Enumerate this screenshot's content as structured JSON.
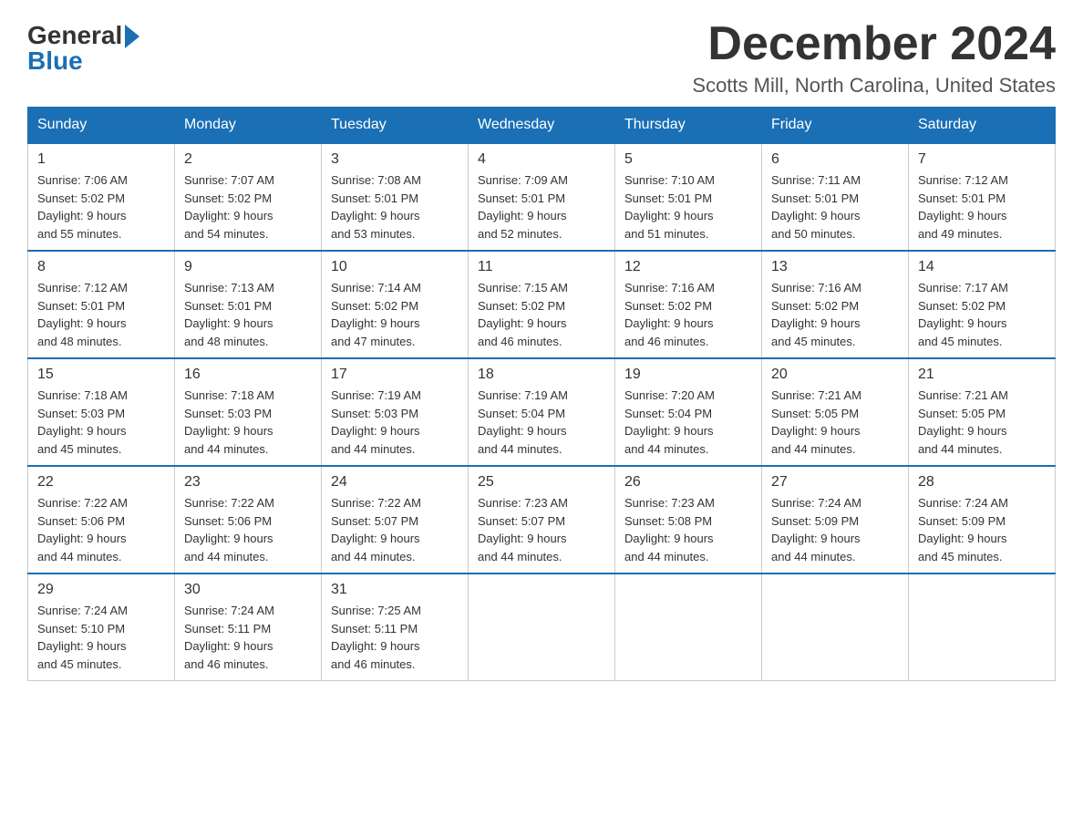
{
  "header": {
    "logo": {
      "general": "General",
      "blue": "Blue",
      "arrow": "▶"
    },
    "title": "December 2024",
    "location": "Scotts Mill, North Carolina, United States"
  },
  "days_of_week": [
    "Sunday",
    "Monday",
    "Tuesday",
    "Wednesday",
    "Thursday",
    "Friday",
    "Saturday"
  ],
  "weeks": [
    [
      {
        "day": "1",
        "sunrise": "7:06 AM",
        "sunset": "5:02 PM",
        "daylight": "9 hours and 55 minutes."
      },
      {
        "day": "2",
        "sunrise": "7:07 AM",
        "sunset": "5:02 PM",
        "daylight": "9 hours and 54 minutes."
      },
      {
        "day": "3",
        "sunrise": "7:08 AM",
        "sunset": "5:01 PM",
        "daylight": "9 hours and 53 minutes."
      },
      {
        "day": "4",
        "sunrise": "7:09 AM",
        "sunset": "5:01 PM",
        "daylight": "9 hours and 52 minutes."
      },
      {
        "day": "5",
        "sunrise": "7:10 AM",
        "sunset": "5:01 PM",
        "daylight": "9 hours and 51 minutes."
      },
      {
        "day": "6",
        "sunrise": "7:11 AM",
        "sunset": "5:01 PM",
        "daylight": "9 hours and 50 minutes."
      },
      {
        "day": "7",
        "sunrise": "7:12 AM",
        "sunset": "5:01 PM",
        "daylight": "9 hours and 49 minutes."
      }
    ],
    [
      {
        "day": "8",
        "sunrise": "7:12 AM",
        "sunset": "5:01 PM",
        "daylight": "9 hours and 48 minutes."
      },
      {
        "day": "9",
        "sunrise": "7:13 AM",
        "sunset": "5:01 PM",
        "daylight": "9 hours and 48 minutes."
      },
      {
        "day": "10",
        "sunrise": "7:14 AM",
        "sunset": "5:02 PM",
        "daylight": "9 hours and 47 minutes."
      },
      {
        "day": "11",
        "sunrise": "7:15 AM",
        "sunset": "5:02 PM",
        "daylight": "9 hours and 46 minutes."
      },
      {
        "day": "12",
        "sunrise": "7:16 AM",
        "sunset": "5:02 PM",
        "daylight": "9 hours and 46 minutes."
      },
      {
        "day": "13",
        "sunrise": "7:16 AM",
        "sunset": "5:02 PM",
        "daylight": "9 hours and 45 minutes."
      },
      {
        "day": "14",
        "sunrise": "7:17 AM",
        "sunset": "5:02 PM",
        "daylight": "9 hours and 45 minutes."
      }
    ],
    [
      {
        "day": "15",
        "sunrise": "7:18 AM",
        "sunset": "5:03 PM",
        "daylight": "9 hours and 45 minutes."
      },
      {
        "day": "16",
        "sunrise": "7:18 AM",
        "sunset": "5:03 PM",
        "daylight": "9 hours and 44 minutes."
      },
      {
        "day": "17",
        "sunrise": "7:19 AM",
        "sunset": "5:03 PM",
        "daylight": "9 hours and 44 minutes."
      },
      {
        "day": "18",
        "sunrise": "7:19 AM",
        "sunset": "5:04 PM",
        "daylight": "9 hours and 44 minutes."
      },
      {
        "day": "19",
        "sunrise": "7:20 AM",
        "sunset": "5:04 PM",
        "daylight": "9 hours and 44 minutes."
      },
      {
        "day": "20",
        "sunrise": "7:21 AM",
        "sunset": "5:05 PM",
        "daylight": "9 hours and 44 minutes."
      },
      {
        "day": "21",
        "sunrise": "7:21 AM",
        "sunset": "5:05 PM",
        "daylight": "9 hours and 44 minutes."
      }
    ],
    [
      {
        "day": "22",
        "sunrise": "7:22 AM",
        "sunset": "5:06 PM",
        "daylight": "9 hours and 44 minutes."
      },
      {
        "day": "23",
        "sunrise": "7:22 AM",
        "sunset": "5:06 PM",
        "daylight": "9 hours and 44 minutes."
      },
      {
        "day": "24",
        "sunrise": "7:22 AM",
        "sunset": "5:07 PM",
        "daylight": "9 hours and 44 minutes."
      },
      {
        "day": "25",
        "sunrise": "7:23 AM",
        "sunset": "5:07 PM",
        "daylight": "9 hours and 44 minutes."
      },
      {
        "day": "26",
        "sunrise": "7:23 AM",
        "sunset": "5:08 PM",
        "daylight": "9 hours and 44 minutes."
      },
      {
        "day": "27",
        "sunrise": "7:24 AM",
        "sunset": "5:09 PM",
        "daylight": "9 hours and 44 minutes."
      },
      {
        "day": "28",
        "sunrise": "7:24 AM",
        "sunset": "5:09 PM",
        "daylight": "9 hours and 45 minutes."
      }
    ],
    [
      {
        "day": "29",
        "sunrise": "7:24 AM",
        "sunset": "5:10 PM",
        "daylight": "9 hours and 45 minutes."
      },
      {
        "day": "30",
        "sunrise": "7:24 AM",
        "sunset": "5:11 PM",
        "daylight": "9 hours and 46 minutes."
      },
      {
        "day": "31",
        "sunrise": "7:25 AM",
        "sunset": "5:11 PM",
        "daylight": "9 hours and 46 minutes."
      },
      null,
      null,
      null,
      null
    ]
  ],
  "labels": {
    "sunrise": "Sunrise:",
    "sunset": "Sunset:",
    "daylight": "Daylight:"
  }
}
